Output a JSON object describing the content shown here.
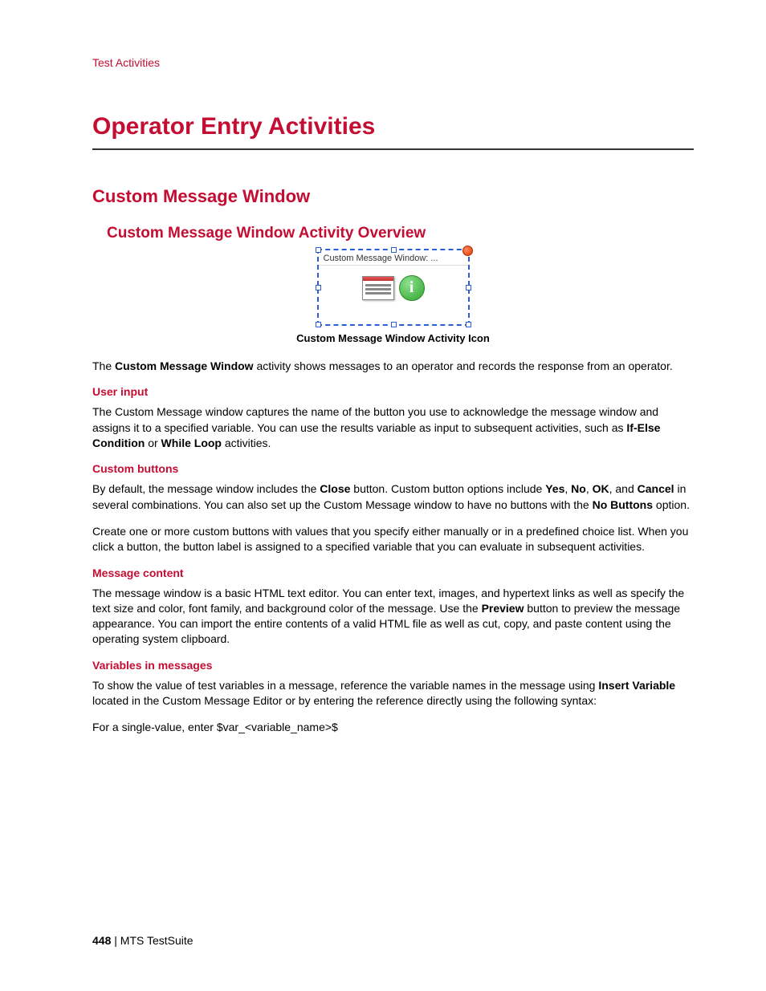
{
  "breadcrumb": "Test Activities",
  "h1": "Operator Entry Activities",
  "h2": "Custom Message Window",
  "h3": "Custom Message Window Activity Overview",
  "icon_header": "Custom Message Window: ...",
  "caption": "Custom Message Window Activity Icon",
  "intro_pre": "The ",
  "intro_bold": "Custom Message Window",
  "intro_post": " activity shows messages to an operator and records the response from an operator.",
  "sec1_h": "User input",
  "sec1_p_pre": "The Custom Message window captures the name of the button you use to acknowledge the message window and assigns it to a specified variable. You can use the results variable as input to subsequent activities, such as ",
  "sec1_b1": "If-Else Condition",
  "sec1_mid": " or ",
  "sec1_b2": "While Loop",
  "sec1_post": " activities.",
  "sec2_h": "Custom buttons",
  "sec2_p1_pre": "By default, the message window includes the ",
  "sec2_b_close": "Close",
  "sec2_p1_mid1": " button. Custom button options include ",
  "sec2_b_yes": "Yes",
  "sec2_comma1": ", ",
  "sec2_b_no": "No",
  "sec2_comma2": ", ",
  "sec2_b_ok": "OK",
  "sec2_p1_mid2": ", and ",
  "sec2_b_cancel": "Cancel",
  "sec2_p1_mid3": " in several combinations. You can also set up the Custom Message window to have no buttons with the ",
  "sec2_b_nobuttons": "No Buttons",
  "sec2_p1_post": " option.",
  "sec2_p2": "Create one or more custom buttons with values that you specify either manually or in a predefined choice list. When you click a button, the button label is assigned to a specified variable that you can evaluate in subsequent activities.",
  "sec3_h": "Message content",
  "sec3_p_pre": "The message window is a basic HTML text editor. You can enter text, images, and hypertext links as well as specify the text size and color, font family, and background color of the message. Use the ",
  "sec3_b_preview": "Preview",
  "sec3_p_post": " button to preview the message appearance. You can import the entire contents of a valid HTML file as well as cut, copy, and paste content using the operating system clipboard.",
  "sec4_h": "Variables in messages",
  "sec4_p1_pre": "To show the value of test variables in a message, reference the variable names in the message using ",
  "sec4_b_insert": "Insert Variable",
  "sec4_p1_post": " located in the Custom Message Editor or by entering the reference directly using the following syntax:",
  "sec4_p2": "For a single-value, enter $var_<variable_name>$",
  "footer_page": "448",
  "footer_sep": " | ",
  "footer_doc": "MTS TestSuite"
}
